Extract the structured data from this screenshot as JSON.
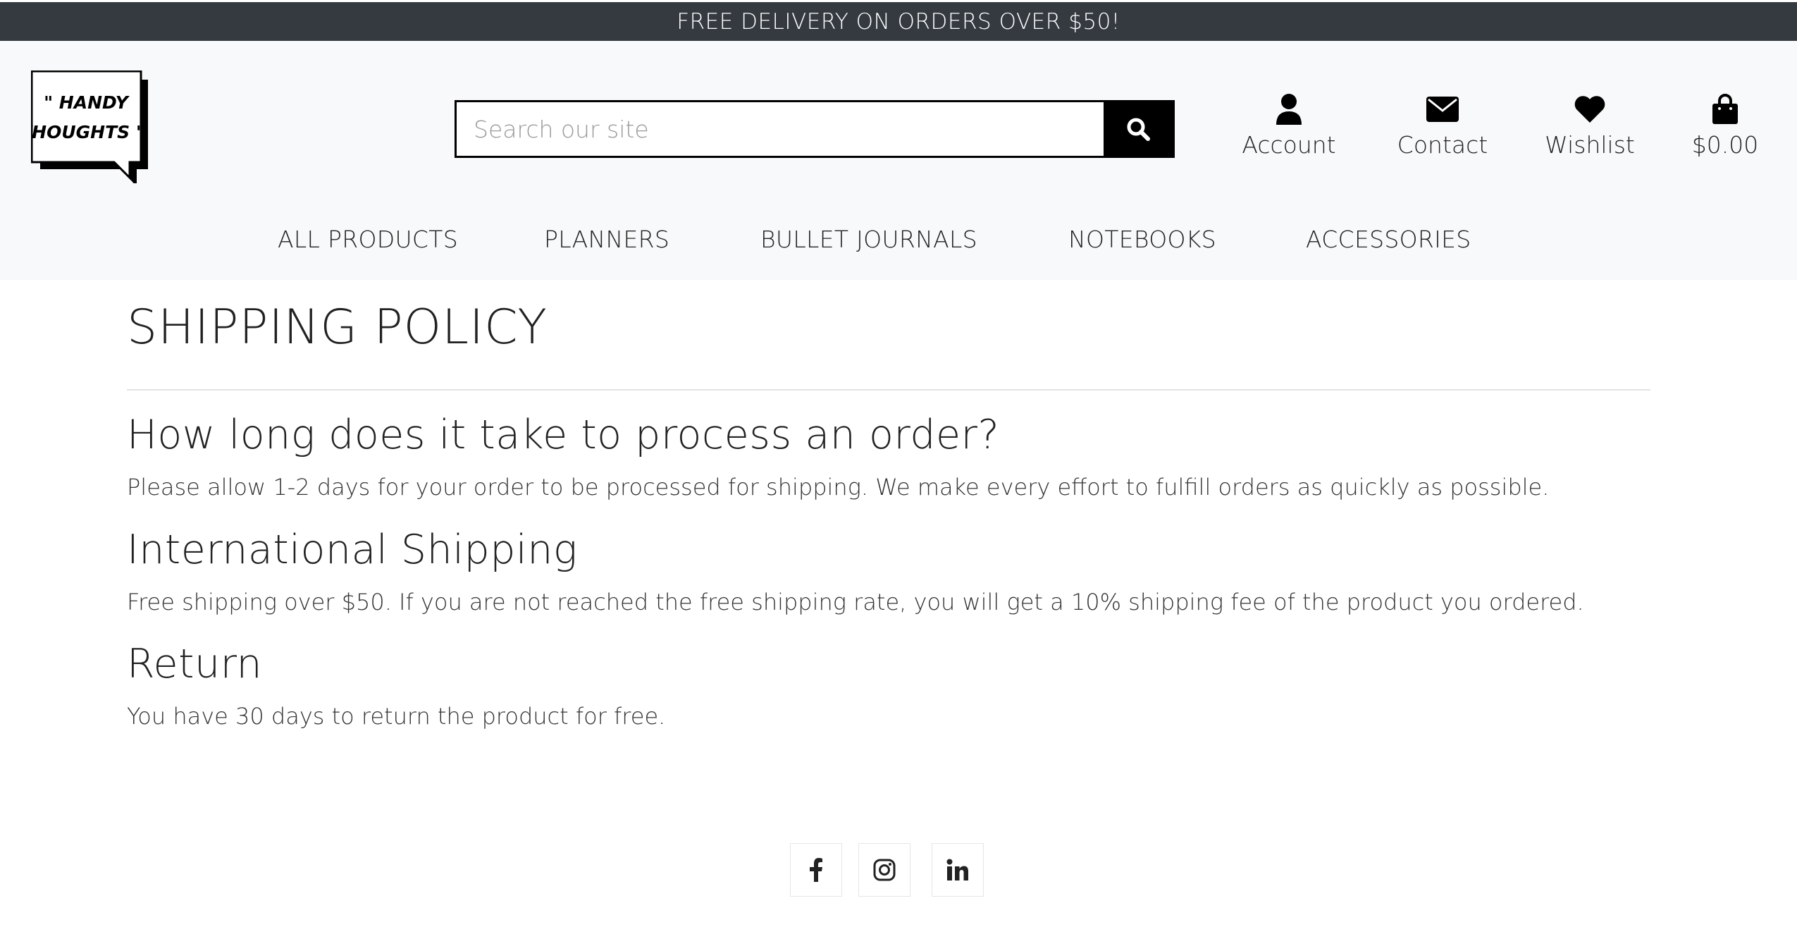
{
  "topbar": {
    "text": "FREE DELIVERY ON ORDERS OVER $50!"
  },
  "logo": {
    "line1": "\" HANDY",
    "line2": "THOUGHTS \""
  },
  "search": {
    "placeholder": "Search our site"
  },
  "header_links": {
    "account": "Account",
    "contact": "Contact",
    "wishlist": "Wishlist",
    "cart_total": "$0.00"
  },
  "nav": {
    "items": [
      "ALL PRODUCTS",
      "PLANNERS",
      "BULLET JOURNALS",
      "NOTEBOOKS",
      "ACCESSORIES"
    ]
  },
  "page": {
    "title": "SHIPPING POLICY",
    "sections": [
      {
        "heading": "How long does it take to process an order?",
        "body": "Please allow 1-2 days for your order to be processed for shipping. We make every effort to fulfill orders as quickly as possible."
      },
      {
        "heading": "International Shipping",
        "body": "Free shipping over $50. If you are not reached the free shipping rate, you will get a 10% shipping fee of the product you ordered."
      },
      {
        "heading": "Return",
        "body": "You have 30 days to return the product for free."
      }
    ]
  },
  "footer": {
    "social_icons": [
      "facebook-icon",
      "instagram-icon",
      "linkedin-icon"
    ]
  },
  "colors": {
    "topbar_bg": "#343a40",
    "header_bg": "#f8f9fa",
    "search_button": "#000000"
  }
}
